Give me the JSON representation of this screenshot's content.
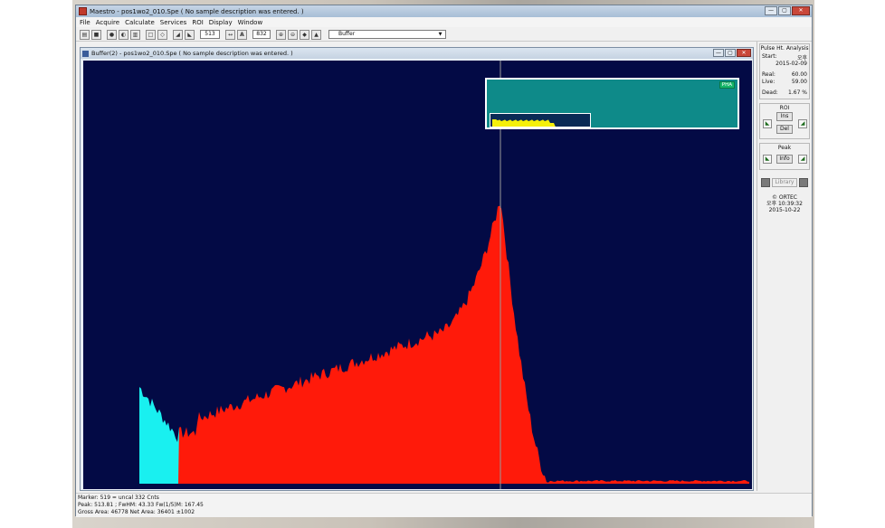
{
  "app": {
    "title": "Maestro - pos1wo2_010.Spe ( No sample description was entered. )",
    "window_controls": [
      "—",
      "▢",
      "✕"
    ]
  },
  "menu": [
    "File",
    "Acquire",
    "Calculate",
    "Services",
    "ROI",
    "Display",
    "Window"
  ],
  "toolbar": {
    "marker_field": "513",
    "log_label": "A",
    "scale_field": "832",
    "buffer_select": "Buffer",
    "icons": [
      "open-icon",
      "save-icon",
      "record-icon",
      "stop-icon",
      "copy-icon",
      "clear-icon",
      "roi-mark-icon",
      "roi-clear-icon",
      "zoom-in-icon",
      "zoom-out-icon",
      "center-icon",
      "baseline-icon"
    ]
  },
  "child": {
    "title": "Buffer(2) - pos1wo2_010.Spe ( No sample description was entered. )",
    "inset_mode": "PHA"
  },
  "status": {
    "line1": "Marker:   519  =               uncal                              332  Cnts",
    "line2": "Peak: 513.81 ;  FwHM: 43.33  Fw(1/5)M: 167.45",
    "line3": "Gross Area: 46778   Net Area: 36401 ±1002"
  },
  "side": {
    "mode_title": "Pulse Ht. Analysis",
    "start_label": "Start:",
    "start_time": "오후",
    "start_date": "2015-02-09",
    "real_label": "Real:",
    "real_value": "60.00",
    "live_label": "Live:",
    "live_value": "59.00",
    "dead_label": "Dead:",
    "dead_value": "1.67  %",
    "roi_title": "ROI",
    "roi_ins": "Ins",
    "roi_del": "Del",
    "peak_title": "Peak",
    "peak_info": "Info",
    "library": "Library",
    "brand": "© ORTEC",
    "clock_time": "오후 10:39:32",
    "clock_date": "2015-10-22"
  },
  "colors": {
    "plot_bg": "#030a45",
    "spectrum": "#ff1a0a",
    "roi": "#19f0f0",
    "inset_bg": "#0e8a89",
    "inset_spectrum": "#f5f00a",
    "marker": "#9a9a9a"
  }
}
